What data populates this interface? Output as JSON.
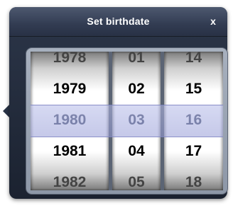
{
  "dialog": {
    "title": "Set birthdate",
    "close_label": "x"
  },
  "picker": {
    "year": [
      "1978",
      "1979",
      "1980",
      "1981",
      "1982"
    ],
    "month": [
      "01",
      "02",
      "03",
      "04",
      "05"
    ],
    "day": [
      "14",
      "15",
      "16",
      "17",
      "18"
    ],
    "selected": {
      "year": "1980",
      "month": "03",
      "day": "16"
    }
  }
}
